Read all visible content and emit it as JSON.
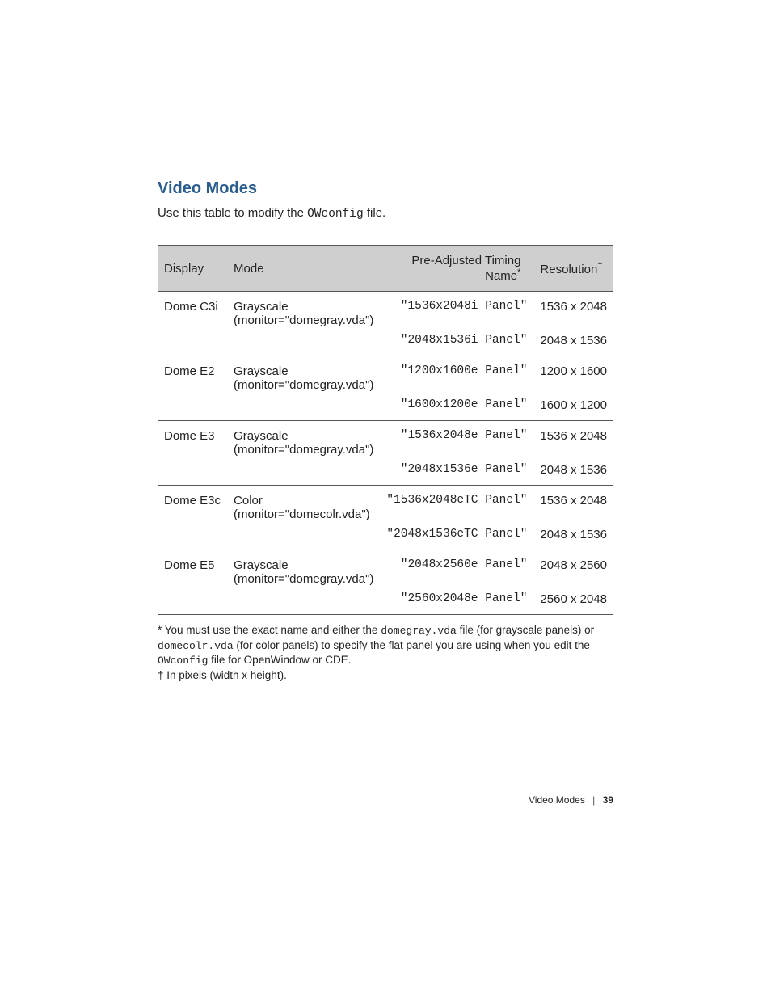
{
  "heading": "Video Modes",
  "intro_pre": "Use this table to modify the ",
  "intro_code": "OWconfig",
  "intro_post": " file.",
  "columns": {
    "display": "Display",
    "mode": "Mode",
    "timing": "Pre-Adjusted Timing Name",
    "timing_sup": "*",
    "resolution": "Resolution",
    "resolution_sup": "†"
  },
  "chart_data": {
    "type": "table",
    "groups": [
      {
        "display": "Dome C3i",
        "mode_label": "Grayscale",
        "monitor_line": "(monitor=\"domegray.vda\")",
        "rows": [
          {
            "timing": "\"1536x2048i Panel\"",
            "resolution": "1536 x 2048"
          },
          {
            "timing": "\"2048x1536i Panel\"",
            "resolution": "2048 x 1536"
          }
        ]
      },
      {
        "display": "Dome E2",
        "mode_label": "Grayscale",
        "monitor_line": "(monitor=\"domegray.vda\")",
        "rows": [
          {
            "timing": "\"1200x1600e Panel\"",
            "resolution": "1200 x 1600"
          },
          {
            "timing": "\"1600x1200e Panel\"",
            "resolution": "1600 x 1200"
          }
        ]
      },
      {
        "display": "Dome E3",
        "mode_label": "Grayscale",
        "monitor_line": "(monitor=\"domegray.vda\")",
        "rows": [
          {
            "timing": "\"1536x2048e Panel\"",
            "resolution": "1536 x 2048"
          },
          {
            "timing": "\"2048x1536e Panel\"",
            "resolution": "2048 x 1536"
          }
        ]
      },
      {
        "display": "Dome E3c",
        "mode_label": "Color",
        "monitor_line": "(monitor=\"domecolr.vda\")",
        "rows": [
          {
            "timing": "\"1536x2048eTC Panel\"",
            "resolution": "1536 x 2048"
          },
          {
            "timing": "\"2048x1536eTC Panel\"",
            "resolution": "2048 x 1536"
          }
        ]
      },
      {
        "display": "Dome E5",
        "mode_label": "Grayscale",
        "monitor_line": "(monitor=\"domegray.vda\")",
        "rows": [
          {
            "timing": "\"2048x2560e Panel\"",
            "resolution": "2048 x 2560"
          },
          {
            "timing": "\"2560x2048e Panel\"",
            "resolution": "2560 x 2048"
          }
        ]
      }
    ]
  },
  "footnotes": {
    "star_pre": "*  You must use the exact name and either the ",
    "star_code1": "domegray.vda",
    "star_mid1": " file (for grayscale panels) or ",
    "star_code2": "domecolr.vda",
    "star_mid2": " (for color panels) to specify the flat panel you are using when you edit the ",
    "star_code3": "OWconfig",
    "star_post": " file for OpenWindow or CDE.",
    "dagger": "†  In pixels (width x height)."
  },
  "footer": {
    "section": "Video Modes",
    "sep": "|",
    "page": "39"
  }
}
